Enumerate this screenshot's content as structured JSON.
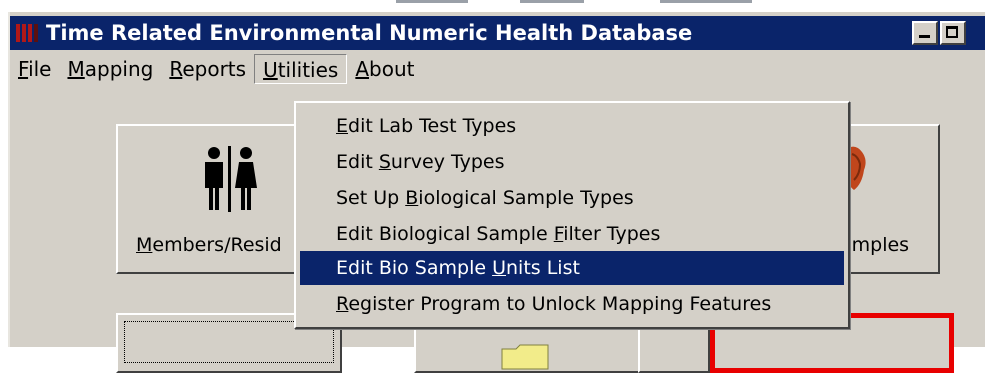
{
  "window": {
    "title": "Time Related Environmental Numeric Health Database"
  },
  "menubar": {
    "items": [
      {
        "pre": "",
        "u": "F",
        "post": "ile"
      },
      {
        "pre": "",
        "u": "M",
        "post": "apping"
      },
      {
        "pre": "",
        "u": "R",
        "post": "eports"
      },
      {
        "pre": "",
        "u": "U",
        "post": "tilities"
      },
      {
        "pre": "",
        "u": "A",
        "post": "bout"
      }
    ]
  },
  "utilities_menu": {
    "items": [
      {
        "pre": "",
        "u": "E",
        "post": "dit Lab Test Types"
      },
      {
        "pre": "Edit ",
        "u": "S",
        "post": "urvey Types"
      },
      {
        "pre": "Set Up ",
        "u": "B",
        "post": "iological Sample Types"
      },
      {
        "pre": "Edit Biological Sample ",
        "u": "F",
        "post": "ilter Types"
      },
      {
        "pre": "Edit Bio Sample ",
        "u": "U",
        "post": "nits List"
      },
      {
        "pre": "",
        "u": "R",
        "post": "egister Program to Unlock Mapping Features"
      }
    ],
    "highlighted_index": 4
  },
  "buttons": {
    "members": {
      "pre": "",
      "u": "M",
      "post": "embers/Resid"
    },
    "samples": {
      "text": "amples"
    }
  },
  "colors": {
    "titlebar": "#0a246a",
    "highlight": "#0a246a",
    "face": "#d4d0c8",
    "alert_border": "#e80000"
  },
  "icons": {
    "app": "bookshelf-icon",
    "members": "man-woman-icon",
    "samples": "sample-icon"
  }
}
